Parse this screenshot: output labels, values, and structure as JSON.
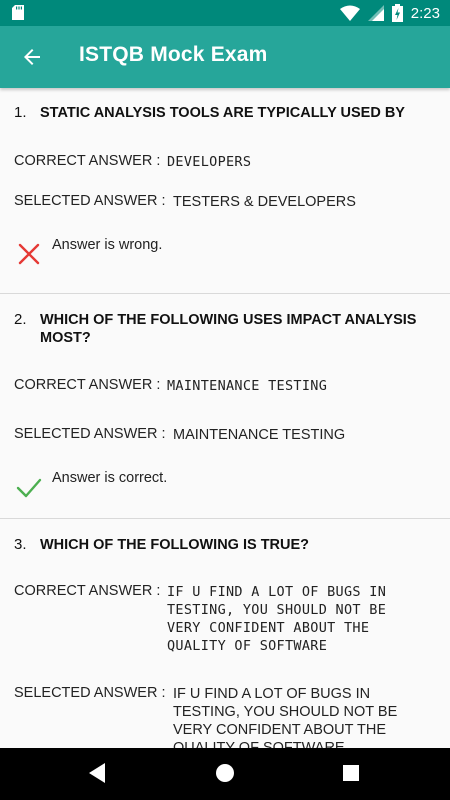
{
  "status": {
    "time": "2:23"
  },
  "app_bar": {
    "title": "ISTQB Mock Exam"
  },
  "labels": {
    "correct": "CORRECT ANSWER :",
    "selected": "SELECTED ANSWER :"
  },
  "questions": [
    {
      "number": "1.",
      "text": "STATIC ANALYSIS TOOLS ARE TYPICALLY USED BY",
      "correct_answer": "DEVELOPERS",
      "selected_answer": "TESTERS & DEVELOPERS",
      "result": "Answer is wrong."
    },
    {
      "number": "2.",
      "text": "WHICH OF THE FOLLOWING USES IMPACT ANALYSIS MOST?",
      "correct_answer": "MAINTENANCE TESTING",
      "selected_answer": "MAINTENANCE TESTING",
      "result": "Answer is correct."
    },
    {
      "number": "3.",
      "text": "WHICH OF THE FOLLOWING IS TRUE?",
      "correct_answer": "IF U FIND A LOT OF BUGS IN TESTING, YOU SHOULD NOT BE VERY CONFIDENT ABOUT THE QUALITY OF SOFTWARE",
      "selected_answer": "IF U FIND A LOT OF BUGS IN TESTING, YOU SHOULD NOT BE VERY CONFIDENT ABOUT THE QUALITY OF SOFTWARE"
    }
  ],
  "colors": {
    "status_bar": "#00897b",
    "app_bar": "#26a69a",
    "wrong": "#e53935",
    "correct": "#4caf50"
  }
}
